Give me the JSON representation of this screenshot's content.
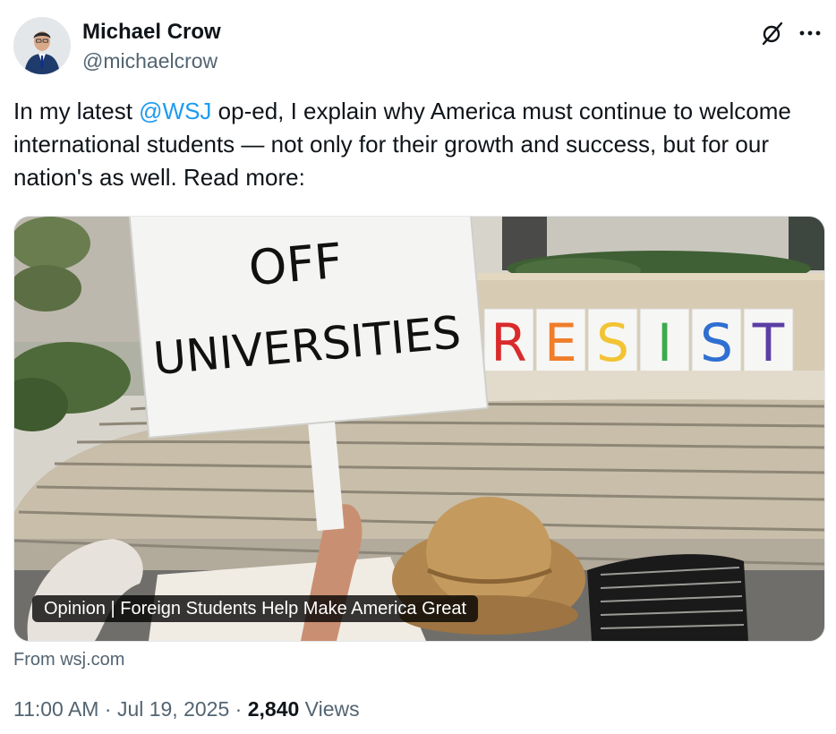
{
  "author": {
    "name": "Michael Crow",
    "handle": "@michaelcrow",
    "avatar_icon": "profile-photo"
  },
  "header_actions": {
    "grok_icon": "grok-icon",
    "more_icon": "more-horizontal-icon"
  },
  "tweet": {
    "text_before": "In my latest ",
    "mention": "@WSJ",
    "text_after": " op-ed, I explain why America must continue to welcome international students — not only for their growth and success, but for our nation's as well. Read more:"
  },
  "card": {
    "image_sign_text": [
      "OFF",
      "UNIVERSITIES"
    ],
    "image_banner_letters": [
      "R",
      "E",
      "S",
      "I",
      "S",
      "T"
    ],
    "image_banner_colors": [
      "#d92b2b",
      "#f07d2a",
      "#f2c333",
      "#3bab4c",
      "#2f6fd1",
      "#5b3fa5"
    ],
    "caption": "Opinion | Foreign Students Help Make America Great",
    "source": "From wsj.com"
  },
  "meta": {
    "time": "11:00 AM",
    "separator": " · ",
    "date": "Jul 19, 2025",
    "views_count": "2,840",
    "views_label": "Views"
  },
  "colors": {
    "link": "#1d9bf0",
    "secondary_text": "#536471",
    "primary_text": "#0f1419"
  }
}
